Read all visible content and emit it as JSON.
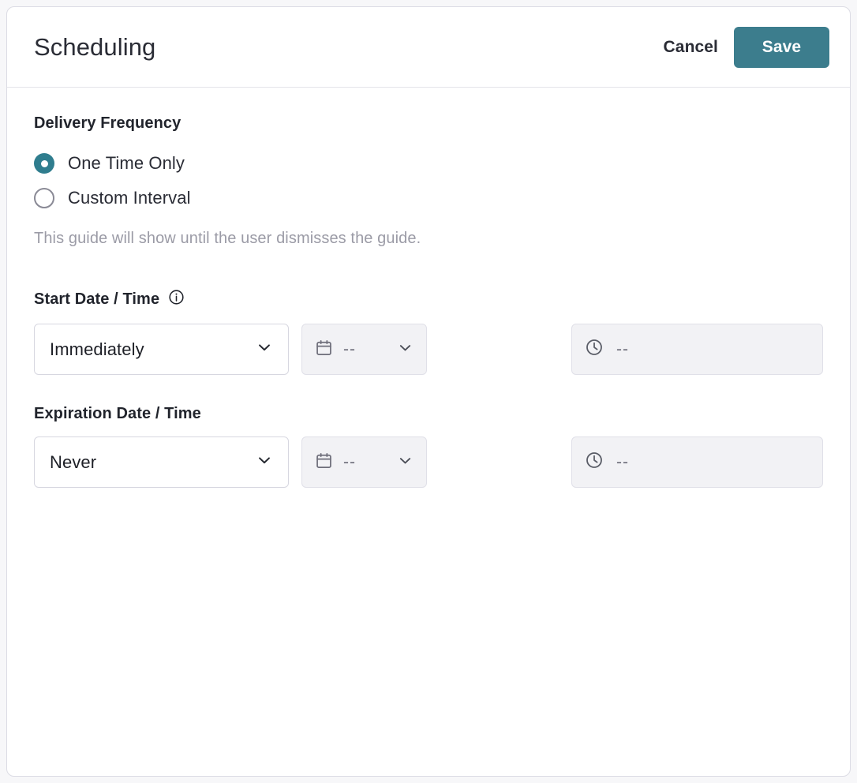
{
  "header": {
    "title": "Scheduling",
    "cancel_label": "Cancel",
    "save_label": "Save",
    "save_color": "#3c7d8d"
  },
  "delivery_frequency": {
    "label": "Delivery Frequency",
    "selected": "One Time Only",
    "accent_color": "#2f7d8e",
    "options": [
      {
        "label": "One Time Only",
        "selected": true
      },
      {
        "label": "Custom Interval",
        "selected": false
      }
    ],
    "helper_text": "This guide will show until the user dismisses the guide."
  },
  "start": {
    "label": "Start Date / Time",
    "info_icon": "info-circle-icon",
    "mode_value": "Immediately",
    "date_icon": "calendar-icon",
    "date_placeholder": "--",
    "time_icon": "clock-icon",
    "time_placeholder": "--",
    "chevron_icon": "chevron-down-icon"
  },
  "expiration": {
    "label": "Expiration Date / Time",
    "mode_value": "Never",
    "date_icon": "calendar-icon",
    "date_placeholder": "--",
    "time_icon": "clock-icon",
    "time_placeholder": "--",
    "chevron_icon": "chevron-down-icon"
  }
}
